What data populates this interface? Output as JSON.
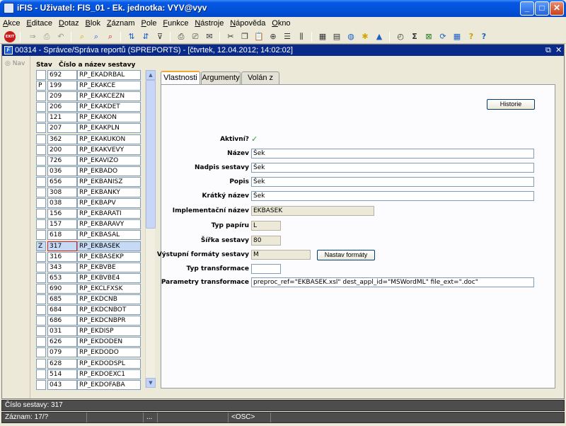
{
  "window": {
    "title": "iFIS - Uživatel: FIS_01 - Ek. jednotka: VYV@vyv",
    "min": "_",
    "max": "□",
    "close": "✕"
  },
  "menu": [
    "Akce",
    "Editace",
    "Dotaz",
    "Blok",
    "Záznam",
    "Pole",
    "Funkce",
    "Nástroje",
    "Nápověda",
    "Okno"
  ],
  "toolbar": {
    "exit_label": "EXIT",
    "sigma": "Σ",
    "help": "?"
  },
  "form": {
    "title": "00314 - Správce/Správa reportů (SPREPORTS) - [čtvrtek, 12.04.2012; 14:02:02]",
    "icon_letter": "F",
    "restore": "⧉",
    "close": "✕"
  },
  "nav": {
    "label": "Nav"
  },
  "list": {
    "header_status": "Stav",
    "header_name": "Číslo a název sestavy",
    "rows": [
      {
        "stav": "",
        "num": "692",
        "name": "RP_EKADRBAL"
      },
      {
        "stav": "P",
        "num": "199",
        "name": "RP_EKAKCE"
      },
      {
        "stav": "",
        "num": "209",
        "name": "RP_EKAKCEZN"
      },
      {
        "stav": "",
        "num": "206",
        "name": "RP_EKAKDET"
      },
      {
        "stav": "",
        "num": "121",
        "name": "RP_EKAKON"
      },
      {
        "stav": "",
        "num": "207",
        "name": "RP_EKAKPLN"
      },
      {
        "stav": "",
        "num": "362",
        "name": "RP_EKAKUKON"
      },
      {
        "stav": "",
        "num": "200",
        "name": "RP_EKAKVEVY"
      },
      {
        "stav": "",
        "num": "726",
        "name": "RP_EKAVIZO"
      },
      {
        "stav": "",
        "num": "036",
        "name": "RP_EKBADO"
      },
      {
        "stav": "",
        "num": "656",
        "name": "RP_EKBANISZ"
      },
      {
        "stav": "",
        "num": "308",
        "name": "RP_EKBANKY"
      },
      {
        "stav": "",
        "num": "038",
        "name": "RP_EKBAPV"
      },
      {
        "stav": "",
        "num": "156",
        "name": "RP_EKBARATI"
      },
      {
        "stav": "",
        "num": "157",
        "name": "RP_EKBARAVY"
      },
      {
        "stav": "",
        "num": "618",
        "name": "RP_EKBASAL"
      },
      {
        "stav": "Z",
        "num": "317",
        "name": "RP_EKBASEK",
        "selected": true
      },
      {
        "stav": "",
        "num": "316",
        "name": "RP_EKBASEKP"
      },
      {
        "stav": "",
        "num": "343",
        "name": "RP_EKBVBE"
      },
      {
        "stav": "",
        "num": "653",
        "name": "RP_EKBVBE4"
      },
      {
        "stav": "",
        "num": "690",
        "name": "RP_EKCLFXSK"
      },
      {
        "stav": "",
        "num": "685",
        "name": "RP_EKDCNB"
      },
      {
        "stav": "",
        "num": "684",
        "name": "RP_EKDCNBOT"
      },
      {
        "stav": "",
        "num": "686",
        "name": "RP_EKDCNBPR"
      },
      {
        "stav": "",
        "num": "031",
        "name": "RP_EKDISP"
      },
      {
        "stav": "",
        "num": "626",
        "name": "RP_EKDODEN"
      },
      {
        "stav": "",
        "num": "079",
        "name": "RP_EKDODO"
      },
      {
        "stav": "",
        "num": "628",
        "name": "RP_EKDODSPL"
      },
      {
        "stav": "",
        "num": "514",
        "name": "RP_EKDOEXC1"
      },
      {
        "stav": "",
        "num": "043",
        "name": "RP_EKDOFABA"
      }
    ]
  },
  "tabs": [
    "Vlastnosti",
    "Argumenty",
    "Volán z"
  ],
  "detail": {
    "historie": "Historie",
    "aktivni_label": "Aktivní?",
    "aktivni_check": "✓",
    "nazev_label": "Název",
    "nazev": "Šek",
    "nadpis_label": "Nadpis sestavy",
    "nadpis": "Šek",
    "popis_label": "Popis",
    "popis": "Šek",
    "kratky_label": "Krátký název",
    "kratky": "Šek",
    "impl_label": "Implementační název",
    "impl": "EKBASEK",
    "typpap_label": "Typ papíru",
    "typpap": "L",
    "sirka_label": "Šířka sestavy",
    "sirka": "80",
    "vystup_label": "Výstupní formáty sestavy",
    "vystup": "M",
    "nastav": "Nastav formáty",
    "typtr_label": "Typ transformace",
    "typtr": "",
    "param_label": "Parametry transformace",
    "param": "preproc_ref=\"EKBASEK.xsl\" dest_appl_id=\"MSWordML\" file_ext=\".doc\""
  },
  "status": {
    "line1": "Číslo sestavy: 317",
    "record": "Záznam: 17/?",
    "dots": "...",
    "osc": "<OSC>"
  }
}
